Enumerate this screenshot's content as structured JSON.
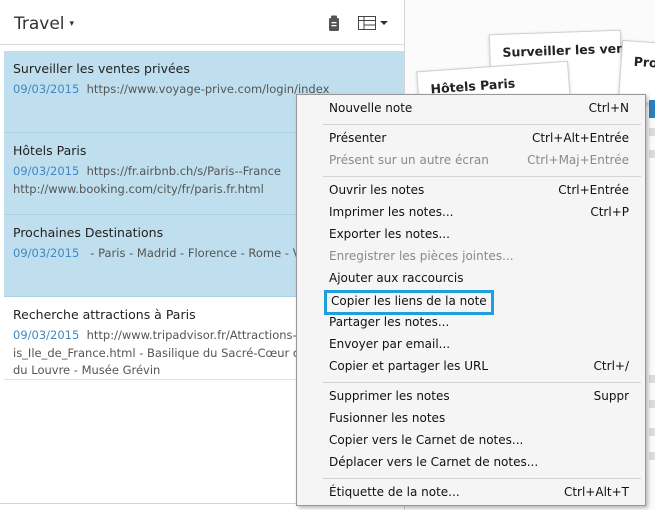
{
  "header": {
    "notebook_title": "Travel",
    "dropdown_caret": "▾",
    "icons": [
      "notebook-clip-icon",
      "view-options-icon"
    ]
  },
  "notes": [
    {
      "title": "Surveiller les ventes privées",
      "date": "09/03/2015",
      "line1": "https://www.voyage-prive.com/login/index",
      "line2": "",
      "selected": true
    },
    {
      "title": "Hôtels Paris",
      "date": "09/03/2015",
      "line1": "https://fr.airbnb.ch/s/Paris--France",
      "line2": "http://www.booking.com/city/fr/paris.fr.html",
      "selected": true
    },
    {
      "title": "Prochaines Destinations",
      "date": "09/03/2015",
      "line1": " - Paris - Madrid - Florence - Rome - Vienn",
      "line2": "",
      "selected": true
    },
    {
      "title": "Recherche attractions à Paris",
      "date": "09/03/2015",
      "line1": "http://www.tripadvisor.fr/Attractions-g18",
      "line2": "is_Ile_de_France.html - Basilique du Sacré-Cœur de M",
      "line3": "du Louvre - Musée Grévin",
      "selected": false
    }
  ],
  "preview": {
    "thumb_titles": [
      "Surveiller les vente",
      "Hôtels Paris",
      "Pro"
    ]
  },
  "context_menu": {
    "items": [
      {
        "label": "Nouvelle note",
        "shortcut": "Ctrl+N",
        "disabled": false
      },
      {
        "label": "Présenter",
        "shortcut": "Ctrl+Alt+Entrée",
        "disabled": false
      },
      {
        "label": "Présent sur un autre écran",
        "shortcut": "Ctrl+Maj+Entrée",
        "disabled": true
      },
      {
        "label": "Ouvrir les notes",
        "shortcut": "Ctrl+Entrée",
        "disabled": false
      },
      {
        "label": "Imprimer les notes...",
        "shortcut": "Ctrl+P",
        "disabled": false
      },
      {
        "label": "Exporter les notes...",
        "shortcut": "",
        "disabled": false
      },
      {
        "label": "Enregistrer les pièces jointes...",
        "shortcut": "",
        "disabled": true
      },
      {
        "label": "Ajouter aux raccourcis",
        "shortcut": "",
        "disabled": false
      },
      {
        "label": "Copier les liens de la note",
        "shortcut": "",
        "disabled": false,
        "highlighted": true
      },
      {
        "label": "Partager les notes...",
        "shortcut": "",
        "disabled": false
      },
      {
        "label": "Envoyer par email...",
        "shortcut": "",
        "disabled": false
      },
      {
        "label": "Copier et partager les URL",
        "shortcut": "Ctrl+/",
        "disabled": false
      },
      {
        "label": "Supprimer les notes",
        "shortcut": "Suppr",
        "disabled": false
      },
      {
        "label": "Fusionner les notes",
        "shortcut": "",
        "disabled": false
      },
      {
        "label": "Copier vers le Carnet de notes...",
        "shortcut": "",
        "disabled": false
      },
      {
        "label": "Déplacer vers le Carnet de notes...",
        "shortcut": "",
        "disabled": false
      },
      {
        "label": "Étiquette de la note...",
        "shortcut": "Ctrl+Alt+T",
        "disabled": false
      }
    ]
  },
  "colors": {
    "selection": "#bfdfef",
    "date_link": "#3f88c5",
    "highlight_border": "#1ea0dc",
    "menu_bg": "#f5f5f5"
  }
}
